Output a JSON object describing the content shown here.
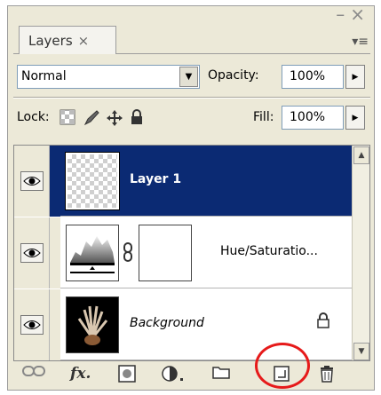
{
  "panel": {
    "tab_label": "Layers",
    "tab_close": "×",
    "window_min": "–",
    "window_close": "×",
    "menu_glyph": "▾≡"
  },
  "blend": {
    "mode": "Normal",
    "opacity_label": "Opacity:",
    "opacity_value": "100%"
  },
  "lock": {
    "label": "Lock:",
    "fill_label": "Fill:",
    "fill_value": "100%"
  },
  "layers": [
    {
      "name": "Layer 1",
      "selected": true
    },
    {
      "name": "Hue/Saturatio...",
      "selected": false
    },
    {
      "name": "Background",
      "selected": false,
      "italic": true,
      "locked": true
    }
  ],
  "toolbar": {
    "icons": [
      "link-layers-icon",
      "fx-icon",
      "mask-icon",
      "adjustment-icon",
      "folder-icon",
      "new-layer-icon",
      "trash-icon"
    ]
  },
  "colors": {
    "selection": "#0b2a73",
    "highlight": "#e61a1a",
    "panel_bg": "#ece9d8"
  }
}
